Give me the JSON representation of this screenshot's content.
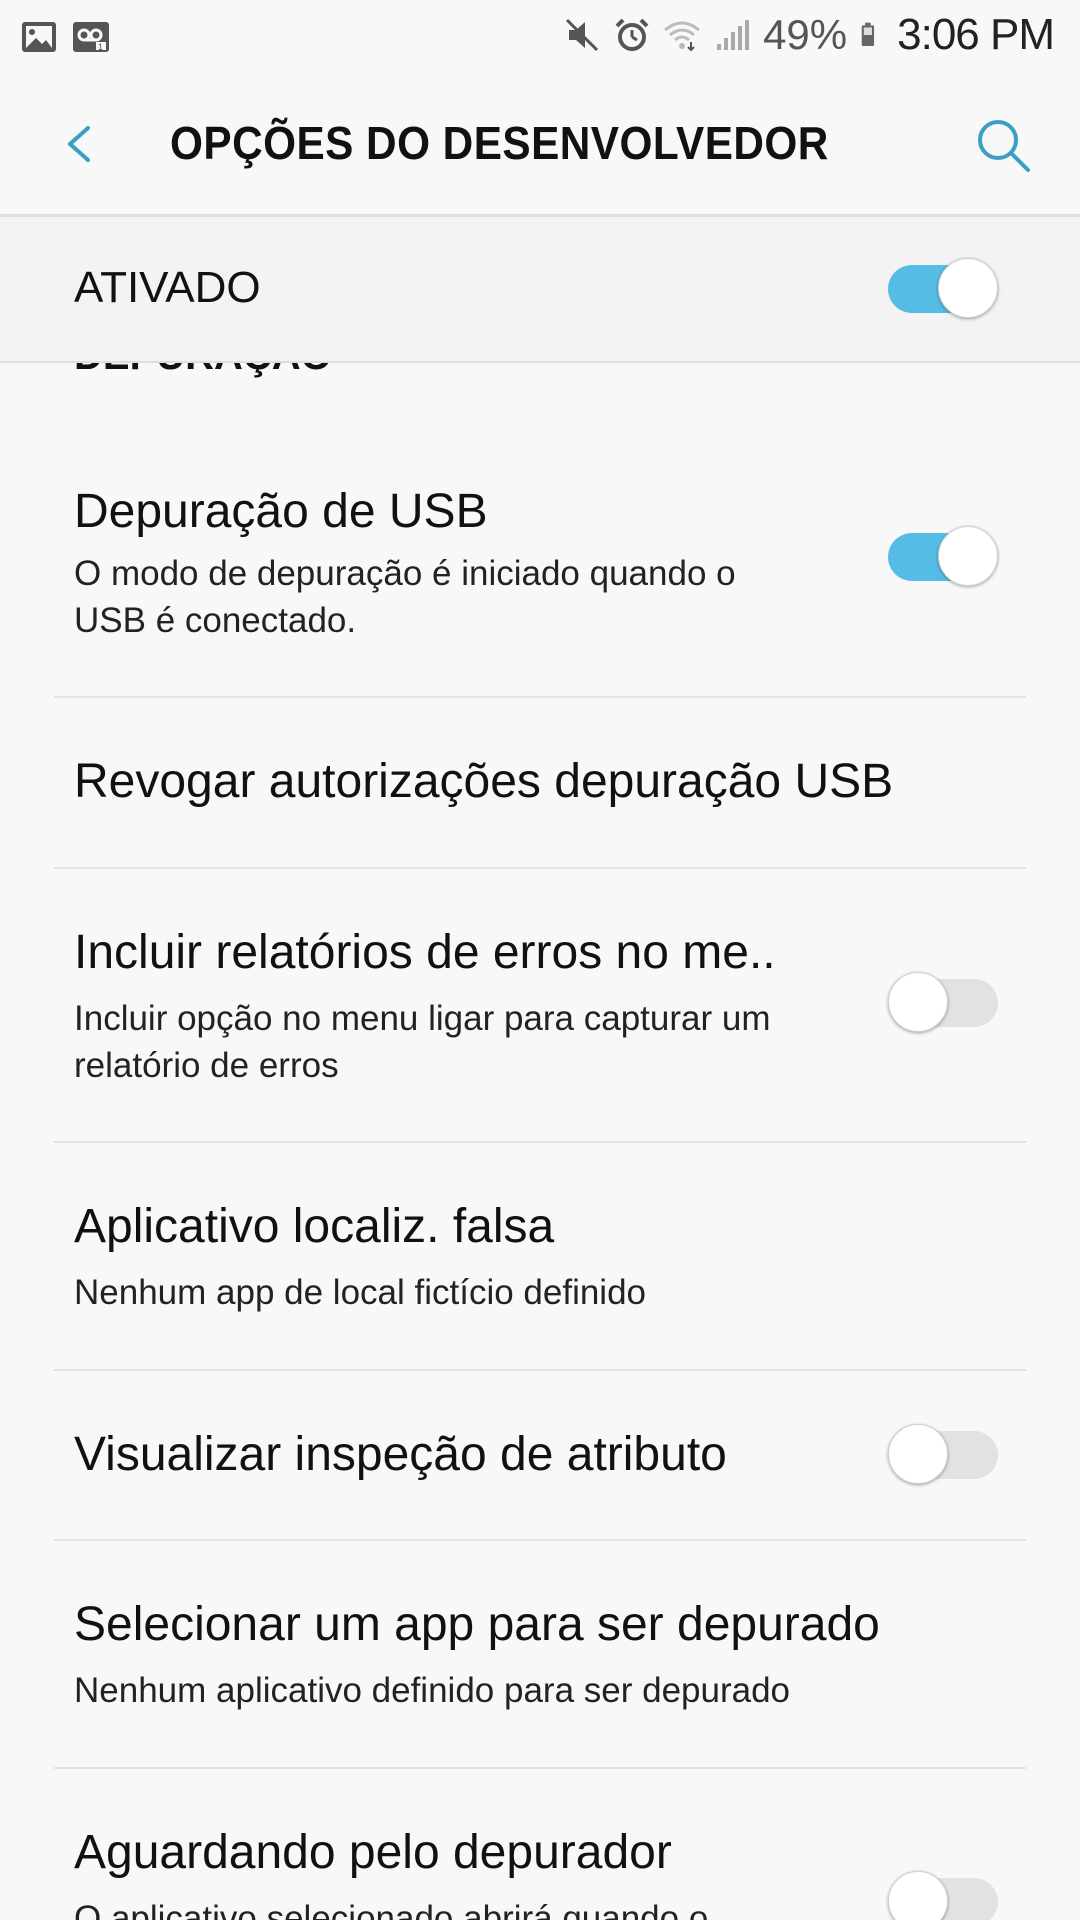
{
  "status_bar": {
    "battery": "49%",
    "time": "3:06 PM",
    "left_icons": [
      "image-icon",
      "voicemail-icon"
    ],
    "right_icons": [
      "mute-icon",
      "alarm-icon",
      "wifi-icon",
      "signal-icon",
      "battery-icon"
    ]
  },
  "header": {
    "title": "OPÇÕES DO DESENVOLVEDOR",
    "back_icon": "chevron-left-icon",
    "search_icon": "search-icon"
  },
  "master_switch": {
    "label": "ATIVADO",
    "on": true
  },
  "section": {
    "label": "DEPURAÇÃO"
  },
  "items": [
    {
      "title": "Depuração de USB",
      "subtitle": "O modo de depuração é iniciado quando o USB é conectado.",
      "toggle": true
    },
    {
      "title": "Revogar autorizações depuração USB"
    },
    {
      "title": "Incluir relatórios de erros no me..",
      "subtitle": "Incluir opção no menu ligar para capturar um relatório de erros",
      "toggle": false
    },
    {
      "title": "Aplicativo localiz. falsa",
      "subtitle": "Nenhum app de local fictício definido"
    },
    {
      "title": "Visualizar inspeção de atributo",
      "toggle": false
    },
    {
      "title": "Selecionar um app para ser depurado",
      "subtitle": "Nenhum aplicativo definido para ser depurado"
    },
    {
      "title": "Aguardando pelo depurador",
      "subtitle": "O aplicativo selecionado abrirá quando o",
      "toggle": false
    }
  ],
  "colors": {
    "accent": "#55bde5",
    "icon_accent": "#3a9fc6",
    "background": "#f8f8f8"
  }
}
